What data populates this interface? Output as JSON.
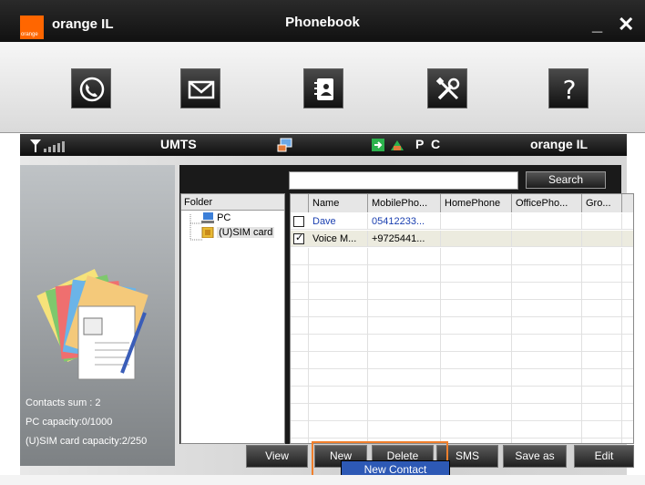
{
  "titlebar": {
    "brand": "orange IL",
    "logo_text": "orange",
    "title": "Phonebook",
    "minimize": "_",
    "close": "✕"
  },
  "toolbar": {
    "tools": [
      "dialer-icon",
      "message-icon",
      "phonebook-icon",
      "settings-icon",
      "help-icon"
    ],
    "help_glyph": "?"
  },
  "status": {
    "network": "UMTS",
    "connection": "P C",
    "operator": "orange IL"
  },
  "stats": {
    "contacts_sum": "Contacts sum : 2",
    "pc_capacity": "PC capacity:0/1000",
    "sim_capacity": "(U)SIM card capacity:2/250"
  },
  "search": {
    "value": "",
    "placeholder": "",
    "button": "Search"
  },
  "folders": {
    "header": "Folder",
    "items": [
      "PC",
      "(U)SIM card"
    ]
  },
  "table": {
    "columns": [
      "Name",
      "MobilePho...",
      "HomePhone",
      "OfficePho...",
      "Gro..."
    ],
    "rows": [
      {
        "checked": false,
        "name": "Dave",
        "mobile": "05412233...",
        "home": "",
        "office": "",
        "group": ""
      },
      {
        "checked": true,
        "name": "Voice M...",
        "mobile": "+9725441...",
        "home": "",
        "office": "",
        "group": ""
      }
    ]
  },
  "buttons": {
    "view": "View",
    "new": "New",
    "delete": "Delete",
    "sms": "SMS",
    "save_as": "Save as",
    "edit": "Edit"
  },
  "context_menu": {
    "item": "New Contact"
  },
  "colors": {
    "brand": "#ff6600",
    "highlight": "#f07f2c",
    "menu_selected": "#2d59b5"
  }
}
